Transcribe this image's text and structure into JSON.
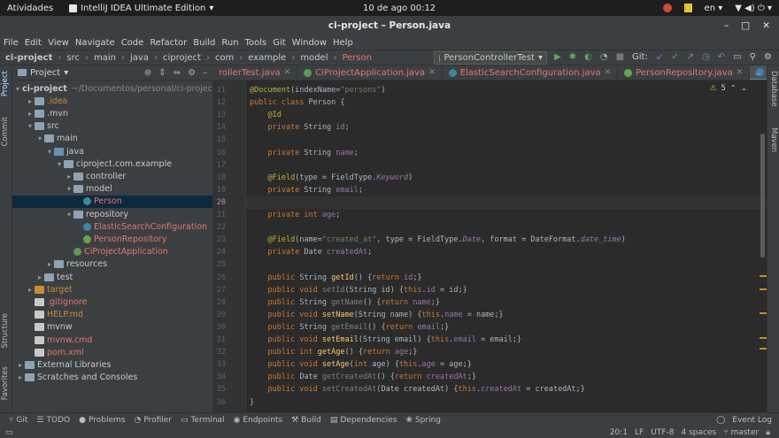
{
  "system": {
    "activities": "Atividades",
    "app": "IntelliJ IDEA Ultimate Edition",
    "clock": "10 de ago  00:12",
    "lang": "en"
  },
  "window": {
    "title": "ci-project – Person.java"
  },
  "menu": [
    "File",
    "Edit",
    "View",
    "Navigate",
    "Code",
    "Refactor",
    "Build",
    "Run",
    "Tools",
    "Git",
    "Window",
    "Help"
  ],
  "breadcrumbs": [
    "ci-project",
    "src",
    "main",
    "java",
    "ciproject",
    "com",
    "example",
    "model",
    "Person"
  ],
  "run_config": "PersonControllerTest",
  "git_label": "Git:",
  "project_panel": {
    "title": "Project"
  },
  "tree": [
    {
      "label": "ci-project",
      "extra": "~/Documentos/personal/ci-project",
      "depth": 0,
      "arrow": "▾",
      "icon": "fold blue"
    },
    {
      "label": ".idea",
      "depth": 1,
      "arrow": "▸",
      "icon": "fold",
      "color": "#c88b3a"
    },
    {
      "label": ".mvn",
      "depth": 1,
      "arrow": "▸",
      "icon": "fold"
    },
    {
      "label": "src",
      "depth": 1,
      "arrow": "▾",
      "icon": "fold"
    },
    {
      "label": "main",
      "depth": 2,
      "arrow": "▾",
      "icon": "fold"
    },
    {
      "label": "java",
      "depth": 3,
      "arrow": "▾",
      "icon": "fold blue"
    },
    {
      "label": "ciproject.com.example",
      "depth": 4,
      "arrow": "▾",
      "icon": "fold"
    },
    {
      "label": "controller",
      "depth": 5,
      "arrow": "▸",
      "icon": "fold"
    },
    {
      "label": "model",
      "depth": 5,
      "arrow": "▾",
      "icon": "fold"
    },
    {
      "label": "Person",
      "depth": 6,
      "arrow": "",
      "icon": "cls",
      "color": "#e37774",
      "selected": true
    },
    {
      "label": "repository",
      "depth": 5,
      "arrow": "▾",
      "icon": "fold"
    },
    {
      "label": "ElasticSearchConfiguration",
      "depth": 6,
      "arrow": "",
      "icon": "cls",
      "color": "#e37774"
    },
    {
      "label": "PersonRepository",
      "depth": 6,
      "arrow": "",
      "icon": "cls ifc",
      "color": "#e37774"
    },
    {
      "label": "CiProjectApplication",
      "depth": 5,
      "arrow": "",
      "icon": "cls grn",
      "color": "#e37774"
    },
    {
      "label": "resources",
      "depth": 3,
      "arrow": "▸",
      "icon": "fold"
    },
    {
      "label": "test",
      "depth": 2,
      "arrow": "▸",
      "icon": "fold"
    },
    {
      "label": "target",
      "depth": 1,
      "arrow": "▸",
      "icon": "fold orange",
      "color": "#c88b3a"
    },
    {
      "label": ".gitignore",
      "depth": 1,
      "arrow": "",
      "icon": "doc",
      "color": "#e37774"
    },
    {
      "label": "HELP.md",
      "depth": 1,
      "arrow": "",
      "icon": "doc",
      "color": "#c88b3a"
    },
    {
      "label": "mvnw",
      "depth": 1,
      "arrow": "",
      "icon": "doc"
    },
    {
      "label": "mvnw.cmd",
      "depth": 1,
      "arrow": "",
      "icon": "doc",
      "color": "#e37774"
    },
    {
      "label": "pom.xml",
      "depth": 1,
      "arrow": "",
      "icon": "doc",
      "color": "#e37774"
    },
    {
      "label": "External Libraries",
      "depth": 0,
      "arrow": "▸",
      "icon": "fold"
    },
    {
      "label": "Scratches and Consoles",
      "depth": 0,
      "arrow": "▸",
      "icon": "fold"
    }
  ],
  "tabs": [
    {
      "label": "rollerTest.java",
      "color": "#e37774"
    },
    {
      "label": "CiProjectApplication.java",
      "color": "#e37774"
    },
    {
      "label": "ElasticSearchConfiguration.java",
      "color": "#e37774"
    },
    {
      "label": "PersonRepository.java",
      "color": "#e37774"
    },
    {
      "label": "Person.java",
      "color": "#6a9fd8",
      "active": true
    }
  ],
  "editor": {
    "warnings": "5",
    "current_line": 20,
    "lines": [
      {
        "n": 11,
        "html": "<span class='ann'>@Document</span>(indexName=<span class='str'>\"persons\"</span>)"
      },
      {
        "n": 12,
        "html": "<span class='kw'>public class</span> Person {"
      },
      {
        "n": 13,
        "html": "    <span class='ann'>@Id</span>"
      },
      {
        "n": 14,
        "html": "    <span class='kw'>private</span> String <span class='fld'>id</span>;"
      },
      {
        "n": 15,
        "html": ""
      },
      {
        "n": 16,
        "html": "    <span class='kw'>private</span> String <span class='fld'>name</span>;"
      },
      {
        "n": 17,
        "html": ""
      },
      {
        "n": 18,
        "html": "    <span class='ann'>@Field</span>(type = FieldType.<span class='fldi'>Keyword</span>)"
      },
      {
        "n": 19,
        "html": "    <span class='kw'>private</span> String <span class='fld'>email</span>;"
      },
      {
        "n": 20,
        "html": ""
      },
      {
        "n": 21,
        "html": "    <span class='kw'>private int</span> <span class='fld'>age</span>;"
      },
      {
        "n": 22,
        "html": ""
      },
      {
        "n": 23,
        "html": "    <span class='ann'>@Field</span>(name=<span class='str'>\"created_at\"</span>, type = FieldType.<span class='fldi'>Date</span>, format = DateFormat.<span class='fldi'>date_time</span>)"
      },
      {
        "n": 24,
        "html": "    <span class='kw'>private</span> Date <span class='fld'>createdAt</span>;"
      },
      {
        "n": 25,
        "html": ""
      },
      {
        "n": 26,
        "html": "    <span class='kw'>public</span> String <span class='meth'>getId</span>() {<span class='kw'>return</span> <span class='fld'>id</span>;}"
      },
      {
        "n": 27,
        "html": "    <span class='kw'>public void</span> <span class='grey'>setId</span>(String id) {<span class='kw'>this</span>.<span class='fld'>id</span> = id;}"
      },
      {
        "n": 28,
        "html": "    <span class='kw'>public</span> String <span class='grey'>getName</span>() {<span class='kw'>return</span> <span class='fld'>name</span>;}"
      },
      {
        "n": 29,
        "html": "    <span class='kw'>public void</span> <span class='meth'>setName</span>(String name) {<span class='kw'>this</span>.<span class='fld'>name</span> = name;}"
      },
      {
        "n": 30,
        "html": "    <span class='kw'>public</span> String <span class='grey'>getEmail</span>() {<span class='kw'>return</span> <span class='fld'>email</span>;}"
      },
      {
        "n": 31,
        "html": "    <span class='kw'>public void</span> <span class='meth'>setEmail</span>(String email) {<span class='kw'>this</span>.<span class='fld'>email</span> = email;}"
      },
      {
        "n": 32,
        "html": "    <span class='kw'>public int</span> <span class='meth'>getAge</span>() {<span class='kw'>return</span> <span class='fld'>age</span>;}"
      },
      {
        "n": 33,
        "html": "    <span class='kw'>public void</span> <span class='meth'>setAge</span>(<span class='kw'>int</span> age) {<span class='kw'>this</span>.<span class='fld'>age</span> = age;}"
      },
      {
        "n": 34,
        "html": "    <span class='kw'>public</span> Date <span class='grey'>getCreatedAt</span>() {<span class='kw'>return</span> <span class='fld'>createdAt</span>;}"
      },
      {
        "n": 35,
        "html": "    <span class='kw'>public void</span> <span class='grey'>setCreatedAt</span>(Date createdAt) {<span class='kw'>this</span>.<span class='fld'>createdAt</span> = createdAt;}"
      },
      {
        "n": 36,
        "html": "}"
      }
    ]
  },
  "left_tools": [
    "Project",
    "Commit",
    "Structure",
    "Favorites"
  ],
  "right_tools": [
    "Database",
    "Maven"
  ],
  "toolwindows": [
    "Git",
    "TODO",
    "Problems",
    "Profiler",
    "Terminal",
    "Endpoints",
    "Build",
    "Dependencies",
    "Spring"
  ],
  "event_log": "Event Log",
  "status": {
    "position": "20:1",
    "line_sep": "LF",
    "encoding": "UTF-8",
    "indent": "4 spaces",
    "branch": "master"
  }
}
